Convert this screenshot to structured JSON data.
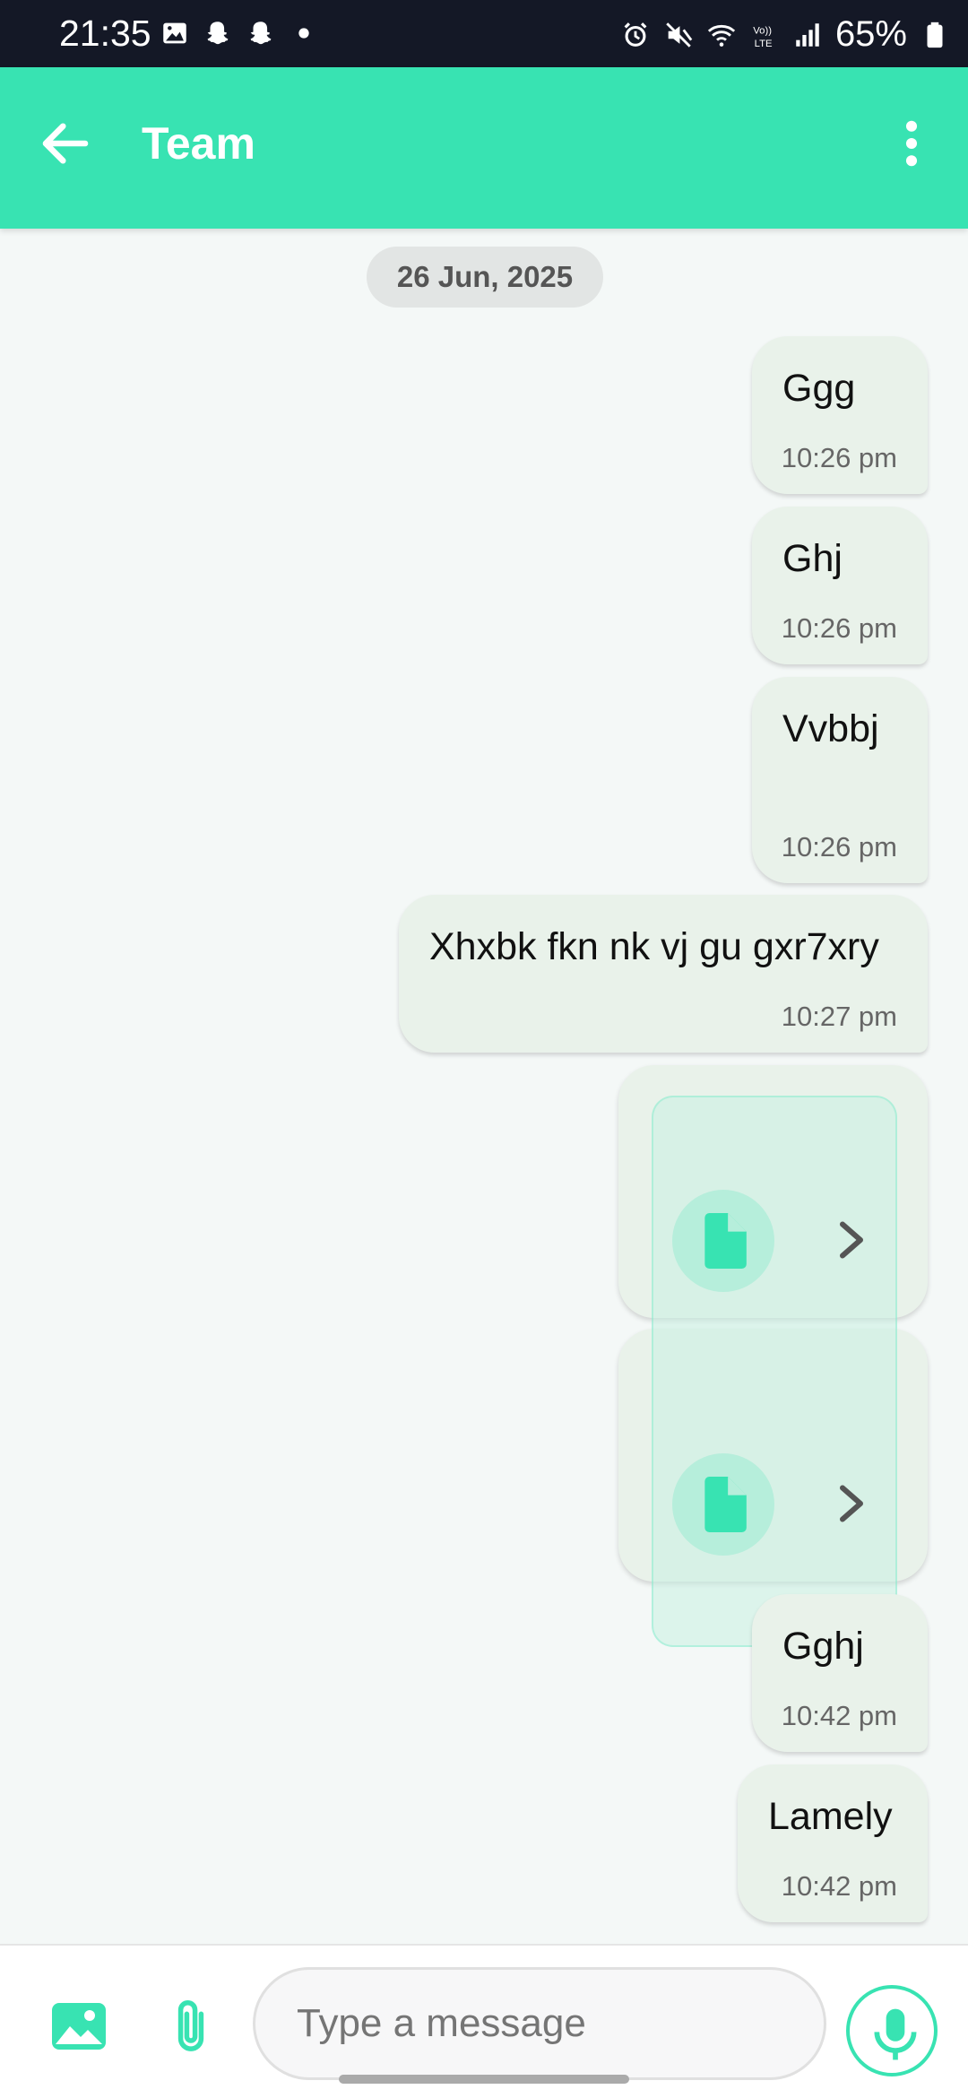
{
  "status_bar": {
    "time": "21:35",
    "battery": "65%"
  },
  "app_bar": {
    "title": "Team"
  },
  "date_separator": "26 Jun, 2025",
  "messages": [
    {
      "text": "Ggg",
      "time": "10:26 pm"
    },
    {
      "text": "Ghj",
      "time": "10:26 pm"
    },
    {
      "text": "Vvbbj",
      "time": "10:26 pm"
    },
    {
      "text": "Xhxbk fkn nk vj gu gxr7xry",
      "time": "10:27 pm"
    },
    {
      "text": "Gghj",
      "time": "10:42 pm"
    },
    {
      "text": "Lamely",
      "time": "10:42 pm"
    }
  ],
  "attachments": [
    {
      "icon": "file-icon"
    },
    {
      "icon": "file-icon"
    }
  ],
  "composer": {
    "placeholder": "Type a message"
  },
  "colors": {
    "accent": "#38e3b2",
    "bubble": "#e9f2ea",
    "status_bar": "#141826"
  }
}
